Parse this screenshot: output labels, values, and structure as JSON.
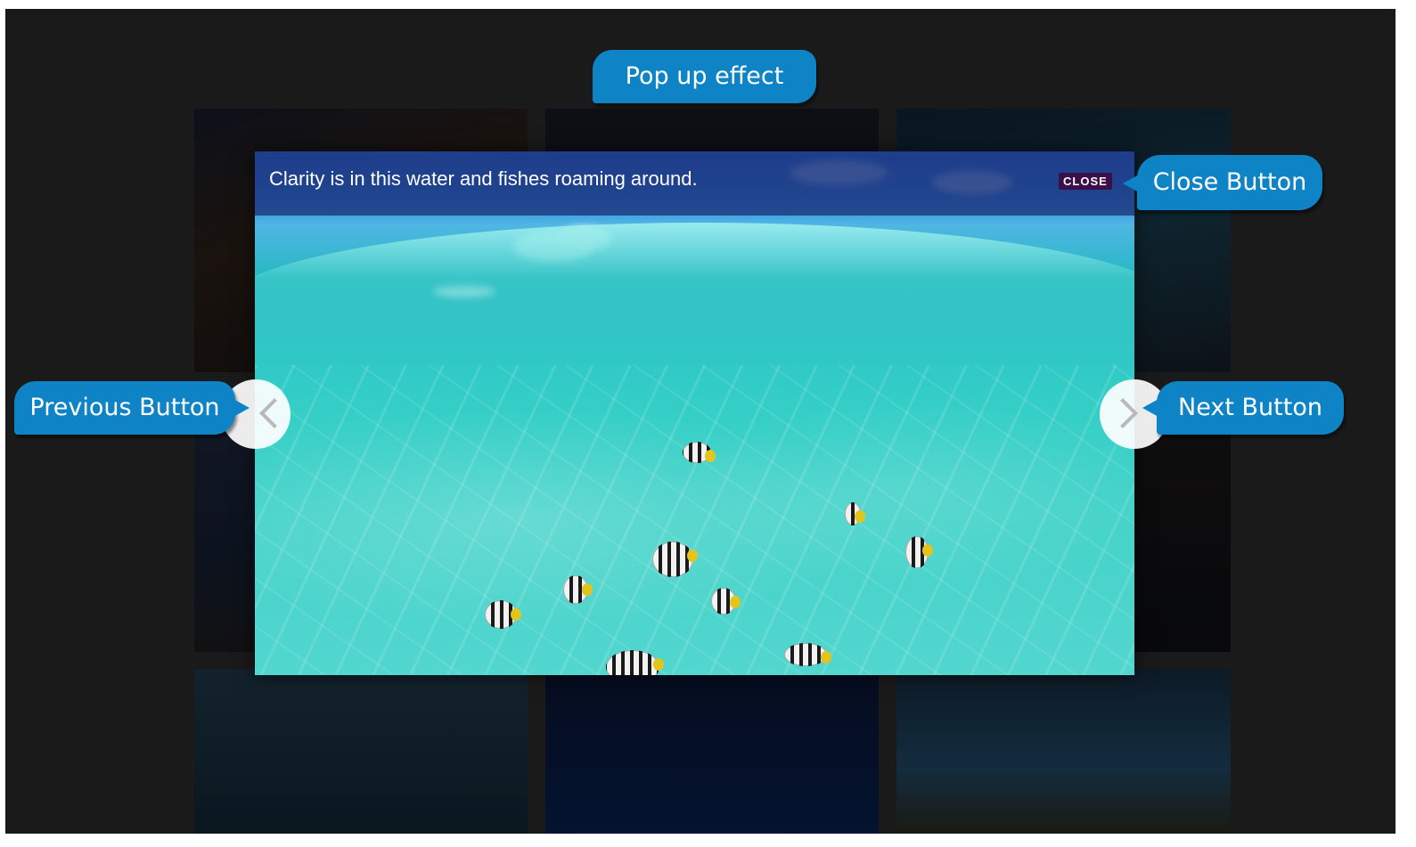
{
  "lightbox": {
    "caption": "Clarity is in this water and fishes roaming around.",
    "close_label": "CLOSE",
    "image_alt_icon": "ocean-photo"
  },
  "annotations": {
    "popup_effect": "Pop up effect",
    "close_button": "Close Button",
    "previous_button": "Previous Button",
    "next_button": "Next Button"
  },
  "colors": {
    "callout": "#0e84c6",
    "backdrop": "#1a1a1a",
    "caption_bar": "#182a6e",
    "close_button": "#3a0f4a"
  }
}
